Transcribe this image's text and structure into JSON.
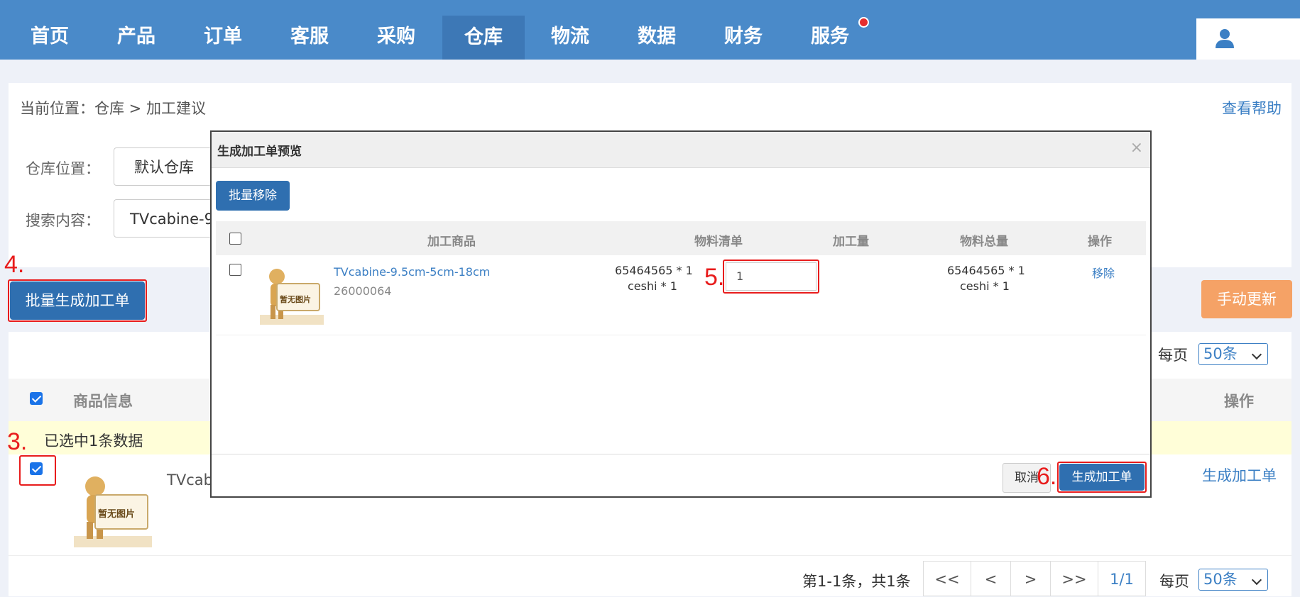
{
  "nav": {
    "items": [
      "首页",
      "产品",
      "订单",
      "客服",
      "采购",
      "仓库",
      "物流",
      "数据",
      "财务",
      "服务"
    ],
    "active_index": 5
  },
  "breadcrumb": {
    "text": "当前位置：仓库 > 加工建议",
    "help": "查看帮助"
  },
  "filters": {
    "warehouse_label": "仓库位置：",
    "warehouse_value": "默认仓库",
    "search_label": "搜索内容：",
    "search_value": "TVcabine-9"
  },
  "annotations": {
    "a3": "3.",
    "a4": "4.",
    "a5": "5.",
    "a6": "6."
  },
  "toolbar": {
    "batch_generate": "批量生成加工单",
    "manual_update": "手动更新"
  },
  "table": {
    "per_page_label": "每页",
    "per_page_value": "50条",
    "col_product": "商品信息",
    "col_action": "操作",
    "selected_notice": "已选中1条数据",
    "row_name": "TVcab",
    "row_action": "生成加工单",
    "img_text": "暂无图片"
  },
  "pager": {
    "summary": "第1-1条，共1条",
    "first": "<<",
    "prev": "<",
    "next": ">",
    "last": ">>",
    "page": "1/1",
    "per_page_label": "每页",
    "per_page_value": "50条"
  },
  "modal": {
    "title": "生成加工单预览",
    "close": "×",
    "batch_remove": "批量移除",
    "headers": {
      "product": "加工商品",
      "bom": "物料清单",
      "qty": "加工量",
      "total": "物料总量",
      "op": "操作"
    },
    "row": {
      "name": "TVcabine-9.5cm-5cm-18cm",
      "sku": "26000064",
      "bom_1": "65464565 * 1",
      "bom_2": "ceshi * 1",
      "qty": "1",
      "total_1": "65464565 * 1",
      "total_2": "ceshi * 1",
      "remove": "移除",
      "img_text": "暂无图片"
    },
    "cancel": "取消",
    "generate": "生成加工单"
  },
  "colors": {
    "nav": "#4a8ac9",
    "primary": "#2f6fb0",
    "accent_orange": "#f5a266",
    "annotation_red": "#e81c1c"
  }
}
